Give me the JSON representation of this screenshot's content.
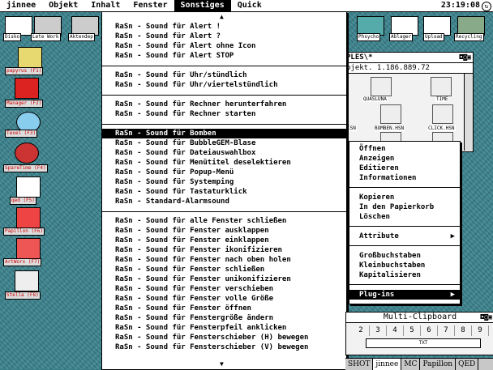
{
  "menubar": {
    "items": [
      "jinnee",
      "Objekt",
      "Inhalt",
      "Fenster",
      "Sonstiges",
      "Quick"
    ],
    "clock": "23:19:08"
  },
  "desktop_top_icons": [
    "Disko",
    "Lete Work",
    "Aktendep"
  ],
  "desktop_right_icons": [
    "Phsycho",
    "Ablager",
    "Upload",
    "Recycling"
  ],
  "sidebar_icons": [
    {
      "label": "papyrus (F1)"
    },
    {
      "label": "Manager (F2)"
    },
    {
      "label": "Texel (F3)"
    },
    {
      "label": "SpareTime (F4)"
    },
    {
      "label": "qed (F5)"
    },
    {
      "label": "Papillon (F6)"
    },
    {
      "label": "ArtWorx (F7)"
    },
    {
      "label": "Stella (F8)"
    }
  ],
  "sound_menu": {
    "groups": [
      [
        "RaSn - Sound für Alert !",
        "RaSn - Sound für Alert ?",
        "RaSn - Sound für Alert ohne Icon",
        "RaSn - Sound für Alert STOP"
      ],
      [
        "RaSn - Sound für Uhr/stündlich",
        "RaSn - Sound für Uhr/viertelstündlich"
      ],
      [
        "RaSn - Sound für Rechner herunterfahren",
        "RaSn - Sound für Rechner starten"
      ],
      [
        "RaSn - Sound für Bomben",
        "RaSn - Sound für BubbleGEM-Blase",
        "RaSn - Sound für Dateiauswahlbox",
        "RaSn - Sound für Menütitel deselektieren",
        "RaSn - Sound für Popup-Menü",
        "RaSn - Sound für Systemping",
        "RaSn - Sound für Tastaturklick",
        "RaSn - Standard-Alarmsound"
      ],
      [
        "RaSn - Sound für alle Fenster schließen",
        "RaSn - Sound für Fenster ausklappen",
        "RaSn - Sound für Fenster einklappen",
        "RaSn - Sound für Fenster ikonifizieren",
        "RaSn - Sound für Fenster nach oben holen",
        "RaSn - Sound für Fenster schließen",
        "RaSn - Sound für Fenster unikonifizieren",
        "RaSn - Sound für Fenster verschieben",
        "RaSn - Sound für Fenster volle Größe",
        "RaSn - Sound für Fenster öffnen",
        "RaSn - Sound für Fenstergröße ändern",
        "RaSn - Sound für Fensterpfeil anklicken",
        "RaSn - Sound für Fensterschieber (H) bewegen",
        "RaSn - Sound für Fensterschieber (V) bewegen"
      ]
    ],
    "selected": "RaSn - Sound für Bomben"
  },
  "window": {
    "title": "PLES\\*",
    "info": "bjekt. 1.186.889.72",
    "files": [
      "QUASLUNA",
      "TIME",
      "BOMBEN.HSN",
      "CLICK.HSN",
      "ISN",
      "ISN"
    ]
  },
  "context_menu": {
    "groups": [
      [
        {
          "label": "Öffnen"
        },
        {
          "label": "Anzeigen"
        },
        {
          "label": "Editieren"
        },
        {
          "label": "Informationen"
        }
      ],
      [
        {
          "label": "Kopieren"
        },
        {
          "label": "In den Papierkorb"
        },
        {
          "label": "Löschen"
        }
      ],
      [
        {
          "label": "Attribute",
          "submenu": "▶"
        }
      ],
      [
        {
          "label": "Großbuchstaben"
        },
        {
          "label": "Kleinbuchstaben"
        },
        {
          "label": "Kapitalisieren"
        }
      ],
      [
        {
          "label": "Plug-ins",
          "submenu": "▶"
        }
      ]
    ],
    "selected": "Plug-ins"
  },
  "clipboard": {
    "title": "Multi-Clipboard",
    "cells": [
      "2",
      "3",
      "4",
      "5",
      "6",
      "7",
      "8",
      "9"
    ],
    "entry": "TXT"
  },
  "taskbar": [
    "SHOT",
    "jinnee",
    "MC",
    "Papillon",
    "QED"
  ]
}
